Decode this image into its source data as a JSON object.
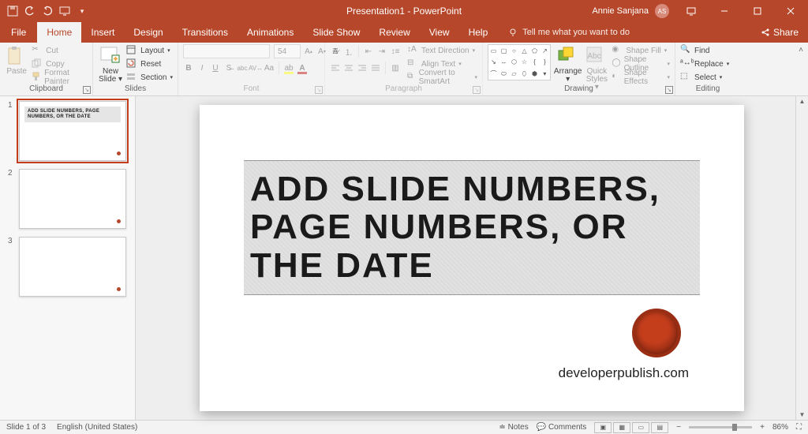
{
  "app": {
    "title": "Presentation1 - PowerPoint"
  },
  "user": {
    "name": "Annie Sanjana",
    "initials": "AS"
  },
  "qat": {
    "save_tip": "Save",
    "undo_tip": "Undo",
    "redo_tip": "Redo",
    "start_tip": "Start From Beginning"
  },
  "tabs": {
    "file": "File",
    "items": [
      "Home",
      "Insert",
      "Design",
      "Transitions",
      "Animations",
      "Slide Show",
      "Review",
      "View",
      "Help"
    ],
    "active_index": 0,
    "tellme": "Tell me what you want to do",
    "share": "Share"
  },
  "ribbon": {
    "clipboard": {
      "label": "Clipboard",
      "paste": "Paste",
      "cut": "Cut",
      "copy": "Copy",
      "format_painter": "Format Painter"
    },
    "slides": {
      "label": "Slides",
      "new_slide": "New Slide",
      "layout": "Layout",
      "reset": "Reset",
      "section": "Section"
    },
    "font": {
      "label": "Font",
      "family": "",
      "size": "54"
    },
    "paragraph": {
      "label": "Paragraph",
      "text_direction": "Text Direction",
      "align_text": "Align Text",
      "convert_smartart": "Convert to SmartArt"
    },
    "drawing": {
      "label": "Drawing",
      "arrange": "Arrange",
      "quick_styles": "Quick Styles",
      "shape_fill": "Shape Fill",
      "shape_outline": "Shape Outline",
      "shape_effects": "Shape Effects"
    },
    "editing": {
      "label": "Editing",
      "find": "Find",
      "replace": "Replace",
      "select": "Select"
    }
  },
  "thumbnails": [
    {
      "num": "1",
      "title": "ADD SLIDE NUMBERS, PAGE NUMBERS, OR THE DATE",
      "active": true
    },
    {
      "num": "2",
      "title": "",
      "active": false
    },
    {
      "num": "3",
      "title": "",
      "active": false
    }
  ],
  "slide": {
    "title": "ADD SLIDE NUMBERS, PAGE NUMBERS, OR THE DATE",
    "subtitle": "developerpublish.com"
  },
  "status": {
    "slide_info": "Slide 1 of 3",
    "language": "English (United States)",
    "notes": "Notes",
    "comments": "Comments",
    "zoom": "86%"
  },
  "colors": {
    "brand": "#B7472A"
  }
}
